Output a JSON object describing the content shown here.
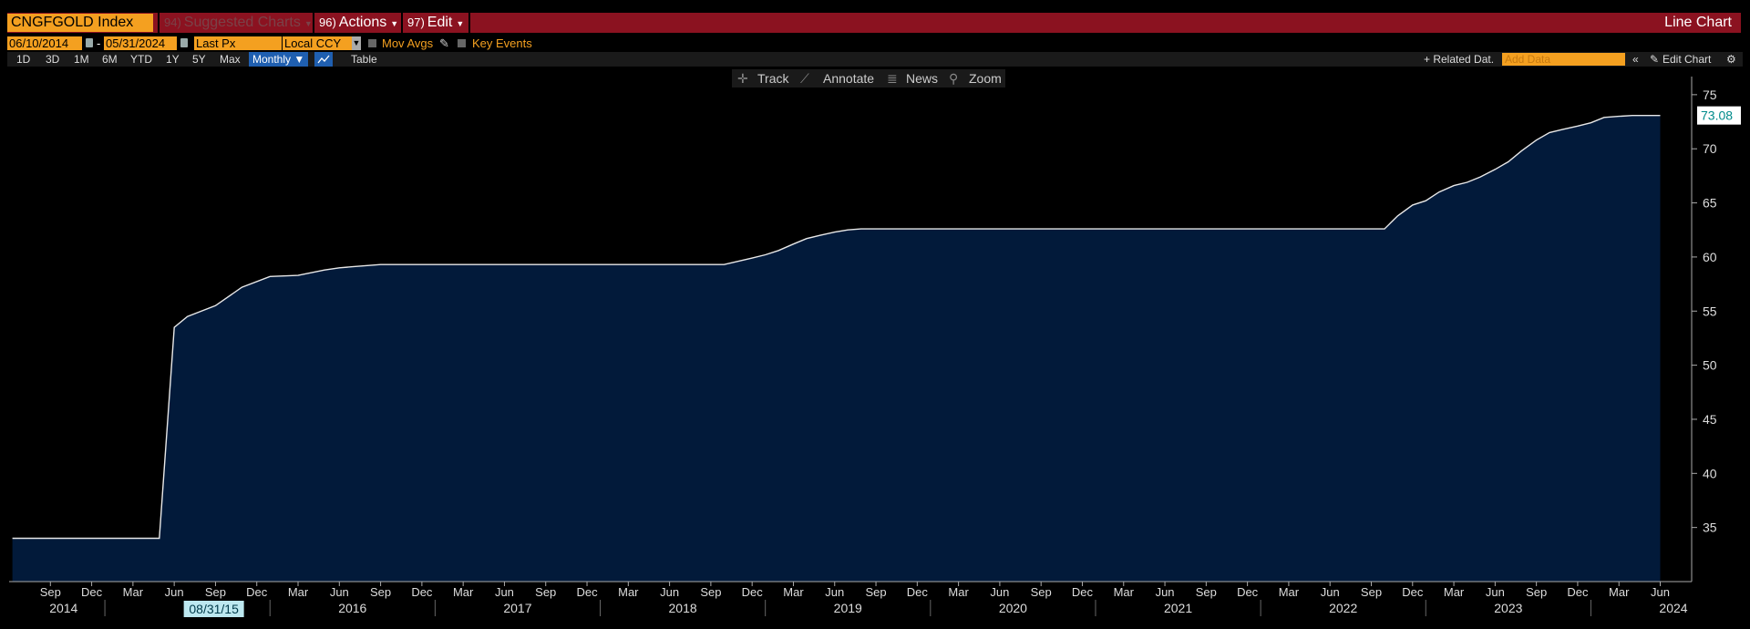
{
  "header": {
    "ticker": "CNGFGOLD Index",
    "suggested": {
      "num": "94)",
      "label": "Suggested Charts"
    },
    "actions": {
      "num": "96)",
      "label": "Actions"
    },
    "edit": {
      "num": "97)",
      "label": "Edit"
    },
    "chart_type": "Line Chart"
  },
  "controls": {
    "start_date": "06/10/2014",
    "end_date": "05/31/2024",
    "field": "Last Px",
    "currency": "Local CCY",
    "mov_avgs": "Mov Avgs",
    "key_events": "Key Events",
    "ranges": [
      "1D",
      "3D",
      "1M",
      "6M",
      "YTD",
      "1Y",
      "5Y",
      "Max"
    ],
    "period": "Monthly ▼",
    "table": "Table",
    "related": "+ Related Dat.",
    "add_data_placeholder": "Add Data",
    "edit_chart": "Edit Chart"
  },
  "chart_toolbar": {
    "track": "Track",
    "annotate": "Annotate",
    "news": "News",
    "zoom": "Zoom"
  },
  "colors": {
    "fill": "#021a3a",
    "line": "#e8e8e8",
    "last_label_bg": "#ffffff",
    "last_label_fg": "#008b8b",
    "date_highlight": "#bde8f0"
  },
  "chart_data": {
    "type": "area",
    "ylim": [
      30,
      76
    ],
    "yticks": [
      35,
      40,
      45,
      50,
      55,
      60,
      65,
      70,
      75
    ],
    "last_value_label": "73.08",
    "cursor_date_label": "08/31/15",
    "month_labels": [
      "Sep",
      "Dec",
      "Mar",
      "Jun",
      "Sep",
      "Dec",
      "Mar",
      "Jun",
      "Sep",
      "Dec",
      "Mar",
      "Jun",
      "Sep",
      "Dec",
      "Mar",
      "Jun",
      "Sep",
      "Dec",
      "Mar",
      "Jun",
      "Sep",
      "Dec",
      "Mar",
      "Jun",
      "Sep",
      "Dec",
      "Mar",
      "Jun",
      "Sep",
      "Dec",
      "Mar",
      "Jun",
      "Sep",
      "Dec",
      "Mar",
      "Jun",
      "Sep",
      "Dec",
      "Mar",
      "Jun"
    ],
    "month_positions": [
      2014.67,
      2014.92,
      2015.17,
      2015.42,
      2015.67,
      2015.92,
      2016.17,
      2016.42,
      2016.67,
      2016.92,
      2017.17,
      2017.42,
      2017.67,
      2017.92,
      2018.17,
      2018.42,
      2018.67,
      2018.92,
      2019.17,
      2019.42,
      2019.67,
      2019.92,
      2020.17,
      2020.42,
      2020.67,
      2020.92,
      2021.17,
      2021.42,
      2021.67,
      2021.92,
      2022.17,
      2022.42,
      2022.67,
      2022.92,
      2023.17,
      2023.42,
      2023.67,
      2023.92,
      2024.17,
      2024.42
    ],
    "year_labels": [
      "2014",
      "2016",
      "2017",
      "2018",
      "2019",
      "2020",
      "2021",
      "2022",
      "2023",
      "2024"
    ],
    "year_positions": [
      2014.75,
      2016.5,
      2017.5,
      2018.5,
      2019.5,
      2020.5,
      2021.5,
      2022.5,
      2023.5,
      2024.5
    ],
    "xlim": [
      2014.42,
      2024.5
    ],
    "series": [
      {
        "x": [
          2014.44,
          2015.33,
          2015.42,
          2015.5,
          2015.67,
          2015.83,
          2016.0,
          2016.17,
          2016.33,
          2016.42,
          2016.5,
          2016.67,
          2016.83,
          2017.0,
          2017.5,
          2018.0,
          2018.5,
          2018.75,
          2018.92,
          2019.0,
          2019.08,
          2019.17,
          2019.25,
          2019.33,
          2019.42,
          2019.5,
          2019.58,
          2019.67,
          2019.75,
          2020.0,
          2020.5,
          2021.0,
          2021.5,
          2022.0,
          2022.5,
          2022.75,
          2022.83,
          2022.92,
          2023.0,
          2023.08,
          2023.17,
          2023.25,
          2023.33,
          2023.42,
          2023.5,
          2023.58,
          2023.67,
          2023.75,
          2023.83,
          2023.92,
          2024.0,
          2024.08,
          2024.17,
          2024.25,
          2024.33,
          2024.42
        ],
        "y": [
          34.0,
          34.0,
          53.5,
          54.5,
          55.5,
          57.2,
          58.2,
          58.3,
          58.8,
          59.0,
          59.1,
          59.3,
          59.3,
          59.3,
          59.3,
          59.3,
          59.3,
          59.3,
          59.9,
          60.2,
          60.6,
          61.2,
          61.7,
          62.0,
          62.3,
          62.5,
          62.6,
          62.6,
          62.6,
          62.6,
          62.6,
          62.6,
          62.6,
          62.6,
          62.6,
          62.6,
          63.8,
          64.8,
          65.2,
          66.0,
          66.6,
          66.9,
          67.4,
          68.1,
          68.8,
          69.8,
          70.8,
          71.5,
          71.8,
          72.1,
          72.4,
          72.9,
          73.0,
          73.08,
          73.08,
          73.08
        ]
      }
    ]
  }
}
